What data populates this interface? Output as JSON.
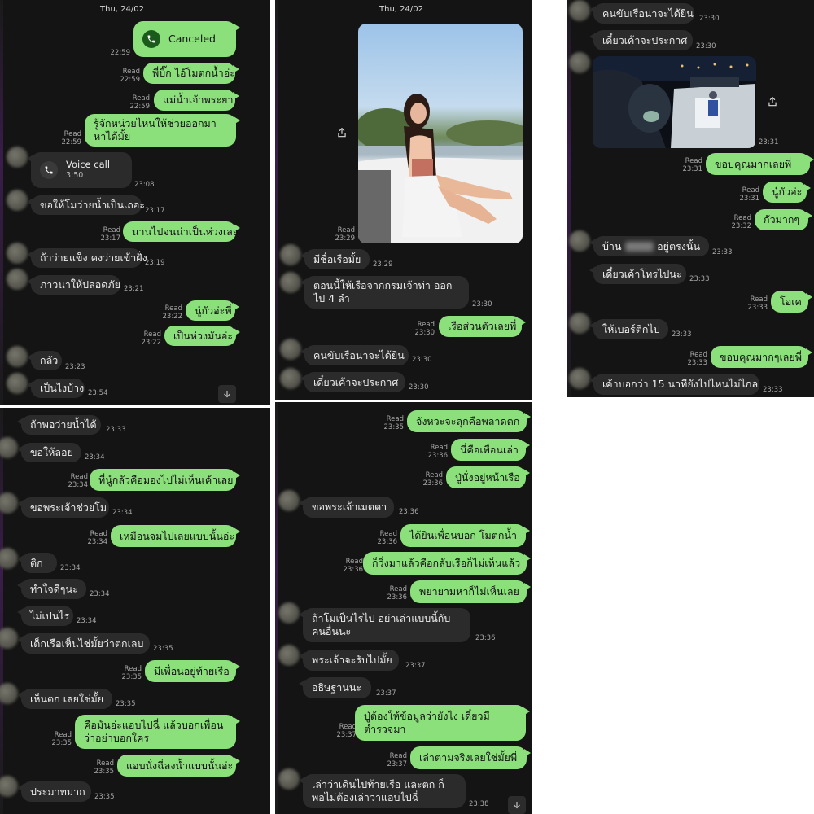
{
  "panels": {
    "p1": {
      "date": "Thu, 24/02",
      "call_canceled": {
        "label": "Canceled",
        "time": "22:59"
      },
      "m1": {
        "text": "พี่บิ๊ก ไอ้โมตกน้ำอ่ะ",
        "read": "Read",
        "time": "22:59"
      },
      "m2": {
        "text": "แม่น้ำเจ้าพระยา",
        "read": "Read",
        "time": "22:59"
      },
      "m3": {
        "text": "รู้จักหน่วยไหนให้ช่วยออกมาหาได้มั้ย",
        "read": "Read",
        "time": "22:59"
      },
      "voice_call": {
        "label": "Voice call",
        "duration": "3:50",
        "time": "23:08"
      },
      "m4": {
        "text": "ขอให้โมว่ายน้ำเป็นเถอะ",
        "time": "23:17"
      },
      "m5": {
        "text": "นานไปจนน่าเป็นห่วงเลย",
        "read": "Read",
        "time": "23:17"
      },
      "m6": {
        "text": "ถ้าว่ายแข็ง คงว่ายเข้าฝั่ง",
        "time": "23:19"
      },
      "m7": {
        "text": "ภาวนาให้ปลอดภัย",
        "time": "23:21"
      },
      "m8": {
        "text": "นู๋กัวอ่ะพี่",
        "read": "Read",
        "time": "23:22"
      },
      "m9": {
        "text": "เป็นห่วงมันอ่ะ",
        "read": "Read",
        "time": "23:22"
      },
      "m10": {
        "text": "กลัว",
        "time": "23:23"
      },
      "m11": {
        "text": "เป็นไงบ้าง",
        "time": "23:54"
      }
    },
    "p2": {
      "date": "Thu, 24/02",
      "photo": {
        "read": "Read",
        "time": "23:29"
      },
      "m1": {
        "text": "มีชื่อเรือมั้ย",
        "time": "23:29"
      },
      "m2": {
        "text": "ตอนนี้ให้เรือจากกรมเจ้าท่า ออกไป 4 ลำ",
        "time": "23:30"
      },
      "m3": {
        "text": "เรือส่วนตัวเลยพี่",
        "read": "Read",
        "time": "23:30"
      },
      "m4": {
        "text": "คนขับเรือน่าจะได้ยิน",
        "time": "23:30"
      },
      "m5": {
        "text": "เดี๋ยวเค้าจะประกาศ",
        "time": "23:30"
      }
    },
    "p3": {
      "m1": {
        "text": "คนขับเรือน่าจะได้ยิน",
        "time": "23:30"
      },
      "m2": {
        "text": "เดี๋ยวเค้าจะประกาศ",
        "time": "23:30"
      },
      "photo": {
        "time": "23:31"
      },
      "m3": {
        "text": "ขอบคุณมากเลยพี่",
        "read": "Read",
        "time": "23:31"
      },
      "m4": {
        "text": "นู๋กัวอ่ะ",
        "read": "Read",
        "time": "23:31"
      },
      "m5": {
        "text": "กัวมากๆ",
        "read": "Read",
        "time": "23:32"
      },
      "m6a": {
        "text": "บ้าน"
      },
      "m6b": {
        "text": "อยู่ตรงนั้น",
        "time": "23:33"
      },
      "m7": {
        "text": "เดี๋ยวเค้าโทรไปนะ",
        "time": "23:33"
      },
      "m8": {
        "text": "โอเค",
        "read": "Read",
        "time": "23:33"
      },
      "m9": {
        "text": "ให้เบอร์ติกไป",
        "time": "23:33"
      },
      "m10": {
        "text": "ขอบคุณมากๆเลยพี่",
        "read": "Read",
        "time": "23:33"
      },
      "m11": {
        "text": "เค้าบอกว่า 15 นาทียังไปไหนไม่ไกล",
        "time": "23:33"
      }
    },
    "p4": {
      "m1": {
        "text": "ถ้าพอว่ายน้ำได้",
        "time": "23:33"
      },
      "m2": {
        "text": "ขอให้ลอย",
        "time": "23:34"
      },
      "m3": {
        "text": "ที่นู๋กลัวคือมองไปไม่เห็นเค้าเลย",
        "read": "Read",
        "time": "23:34"
      },
      "m4": {
        "text": "ขอพระเจ้าช่วยโม",
        "time": "23:34"
      },
      "m5": {
        "text": "เหมือนจมไปเลยแบบนั้นอ่ะ",
        "read": "Read",
        "time": "23:34"
      },
      "m6": {
        "text": "ติก",
        "time": "23:34"
      },
      "m7": {
        "text": "ทำใจดีๆนะ",
        "time": "23:34"
      },
      "m8": {
        "text": "ไม่เปนไร",
        "time": "23:34"
      },
      "m9": {
        "text": "เด็กเรือเห็นไช่มั้ยว่าตกเลบ",
        "time": "23:35"
      },
      "m10": {
        "text": "มีเพื่อนอยู่ท้ายเรือ",
        "read": "Read",
        "time": "23:35"
      },
      "m11": {
        "text": "เห็นตก เลยใช่มั้ย",
        "time": "23:35"
      },
      "m12": {
        "text": "คือมันอ่ะแอบไปฉี่ แล้วบอกเพื่อนว่าอย่าบอกใคร",
        "read": "Read",
        "time": "23:35"
      },
      "m13": {
        "text": "แอบนั่งฉี่ลงน้ำแบบนั้นอ่ะ",
        "read": "Read",
        "time": "23:35"
      },
      "m14": {
        "text": "ประมาทมาก",
        "time": "23:35"
      }
    },
    "p5": {
      "m1": {
        "text": "จังหวะจะลุกคือพลาดตก",
        "read": "Read",
        "time": "23:35"
      },
      "m2": {
        "text": "นี่คือเพื่อนเล่า",
        "read": "Read",
        "time": "23:36"
      },
      "m3": {
        "text": "ปู่นั่งอยู่หน้าเรือ",
        "read": "Read",
        "time": "23:36"
      },
      "m4": {
        "text": "ขอพระเจ้าเมตตา",
        "time": "23:36"
      },
      "m5": {
        "text": "ได้ยินเพื่อนบอก โมตกน้ำ",
        "read": "Read",
        "time": "23:36"
      },
      "m6": {
        "text": "ก็วิ่งมาแล้วคือกลับเรือก็ไม่เห็นแล้ว",
        "read": "Read",
        "time": "23:36"
      },
      "m7": {
        "text": "พยายามหาก็ไม่เห็นเลย",
        "read": "Read",
        "time": "23:36"
      },
      "m8": {
        "text": "ถ้าโมเป็นไรไป อย่าเล่าแบบนี้กับคนอื่นนะ",
        "time": "23:36"
      },
      "m9": {
        "text": "พระเจ้าจะรับไปมั้ย",
        "time": "23:37"
      },
      "m10": {
        "text": "อธิษฐานนะ",
        "time": "23:37"
      },
      "m11": {
        "text": "ปู่ต้องให้ข้อมูลว่ายังไง เดี๋ยวมีตำรวจมา",
        "read": "Read",
        "time": "23:37"
      },
      "m12": {
        "text": "เล่าตามจริงเลยใช่มั้ยพี่",
        "read": "Read",
        "time": "23:37"
      },
      "m13": {
        "text": "เล่าว่าเดินไปท้ายเรือ และตก ก็พอไม่ต้องเล่าว่าแอบไปฉี่",
        "time": "23:38"
      }
    }
  },
  "icons": {
    "phone": "phone-icon",
    "share": "share-icon",
    "scroll_down": "arrow-down-icon"
  },
  "colors": {
    "outgoing_bubble": "#8ce07c",
    "incoming_bubble": "#2b2b2b",
    "background": "#141414",
    "call_icon_bg": "#1f6b1f"
  }
}
